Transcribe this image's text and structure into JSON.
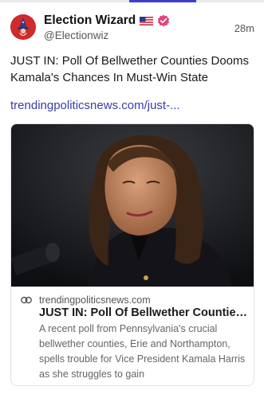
{
  "post": {
    "author_name": "Election Wizard",
    "handle": "@Electionwiz",
    "time": "28m",
    "text": "JUST IN: Poll Of Bellwether Counties Dooms Kamala's Chances In Must-Win State",
    "link": "trendingpoliticsnews.com/just-..."
  },
  "link_card": {
    "domain": "trendingpoliticsnews.com",
    "title": "JUST IN: Poll Of Bellwether Counties ...",
    "description": "A recent poll from Pennsylvania's crucial bellwether counties, Erie and Northampton, spells trouble for Vice President Kamala Harris as she struggles to gain"
  },
  "icons": {
    "avatar": "wizard-avatar",
    "flag": "us-flag-icon",
    "verified": "verified-badge-icon",
    "link": "link-icon"
  },
  "colors": {
    "accent": "#3c3fd0",
    "link": "#3a3ca8",
    "verified": "#e0457b",
    "avatar_bg": "#cf2b2b"
  }
}
